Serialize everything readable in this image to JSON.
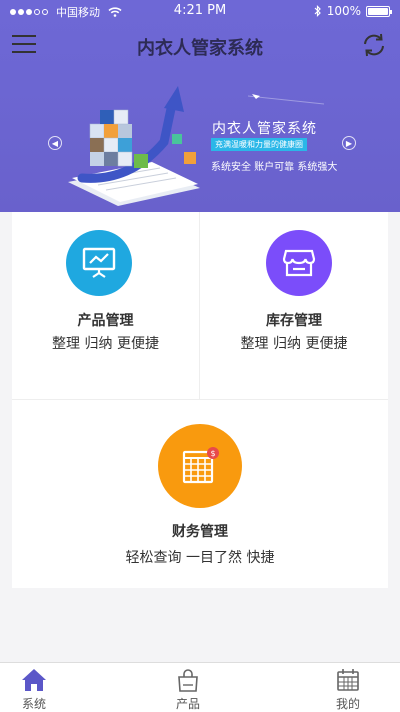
{
  "status_bar": {
    "carrier": "中国移动",
    "time": "4:21 PM",
    "battery": "100%"
  },
  "header": {
    "title": "内衣人管家系统"
  },
  "banner": {
    "title": "内衣人管家系统",
    "tag": "充满温暖和力量的健康圈",
    "subtitle": "系统安全 账户可靠 系统强大"
  },
  "modules": [
    {
      "title": "产品管理",
      "subtitle": "整理 归纳 更便捷",
      "icon": "presentation-chart-icon",
      "color": "#1fa8e0"
    },
    {
      "title": "库存管理",
      "subtitle": "整理 归纳 更便捷",
      "icon": "storefront-icon",
      "color": "#7b4dfa"
    },
    {
      "title": "财务管理",
      "subtitle": "轻松查询 一目了然 快捷",
      "icon": "ledger-icon",
      "color": "#f99a0e"
    }
  ],
  "tabbar": {
    "items": [
      {
        "label": "系统",
        "icon": "home-icon",
        "active": true
      },
      {
        "label": "产品",
        "icon": "shopping-bag-icon",
        "active": false
      },
      {
        "label": "我的",
        "icon": "calendar-icon",
        "active": false
      }
    ]
  },
  "colors": {
    "header_bg": "#6b65d1",
    "tab_active": "#5b57c8"
  }
}
